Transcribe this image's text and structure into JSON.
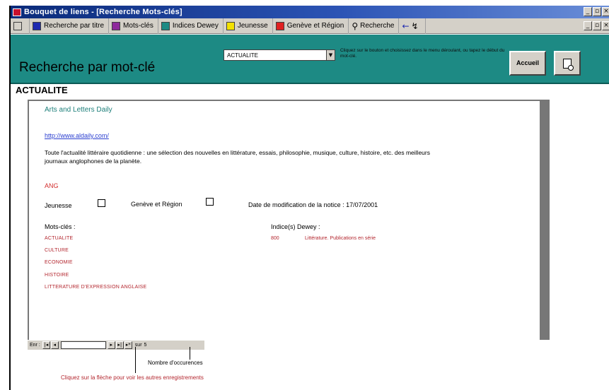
{
  "window": {
    "title": "Bouquet de liens - [Recherche Mots-clés]",
    "buttons": [
      "_",
      "▫",
      "×"
    ]
  },
  "toolbar": {
    "items": [
      {
        "label": "Recherche par titre",
        "color": "#1e2ab0"
      },
      {
        "label": "Mots-clés",
        "color": "#8e2a9c"
      },
      {
        "label": "Indices Dewey",
        "color": "#1d8a84"
      },
      {
        "label": "Jeunesse",
        "color": "#f3e100"
      },
      {
        "label": "Genève et Région",
        "color": "#e02020"
      }
    ],
    "search_label": "Recherche",
    "back_glyph": "←"
  },
  "header": {
    "title": "Recherche par mot-clé",
    "combo_value": "ACTUALITE",
    "hint": "Cliquez sur le bouton et choisissez dans le menu déroulant, ou tapez le début du mot-clé.",
    "accueil_label": "Accueil"
  },
  "record": {
    "heading": "ACTUALITE",
    "site_title": "Arts and Letters Daily",
    "url": "http://www.aldaily.com/",
    "description": "Toute l'actualité littéraire quotidienne : une sélection des nouvelles en littérature, essais, philosophie, musique, culture, histoire, etc. des meilleurs journaux anglophones de la planète.",
    "language": "ANG",
    "jeunesse_label": "Jeunesse",
    "geneve_label": "Genève et Région",
    "date_label": "Date de modification de la notice : 17/07/2001",
    "keywords_label": "Mots-clés :",
    "keywords": [
      "ACTUALITE",
      "CULTURE",
      "ECONOMIE",
      "HISTOIRE",
      "LITTERATURE D'EXPRESSION ANGLAISE"
    ],
    "dewey_label": "Indice(s) Dewey :",
    "dewey_code": "800",
    "dewey_text": "Littérature. Publications en série"
  },
  "navigation": {
    "label": "Enr :",
    "of_label": "sur",
    "count": "5"
  },
  "annotations": {
    "count_note": "Nombre d'occurences",
    "arrow_note": "Cliquez sur la flèche pour voir les autres enregistrements"
  }
}
